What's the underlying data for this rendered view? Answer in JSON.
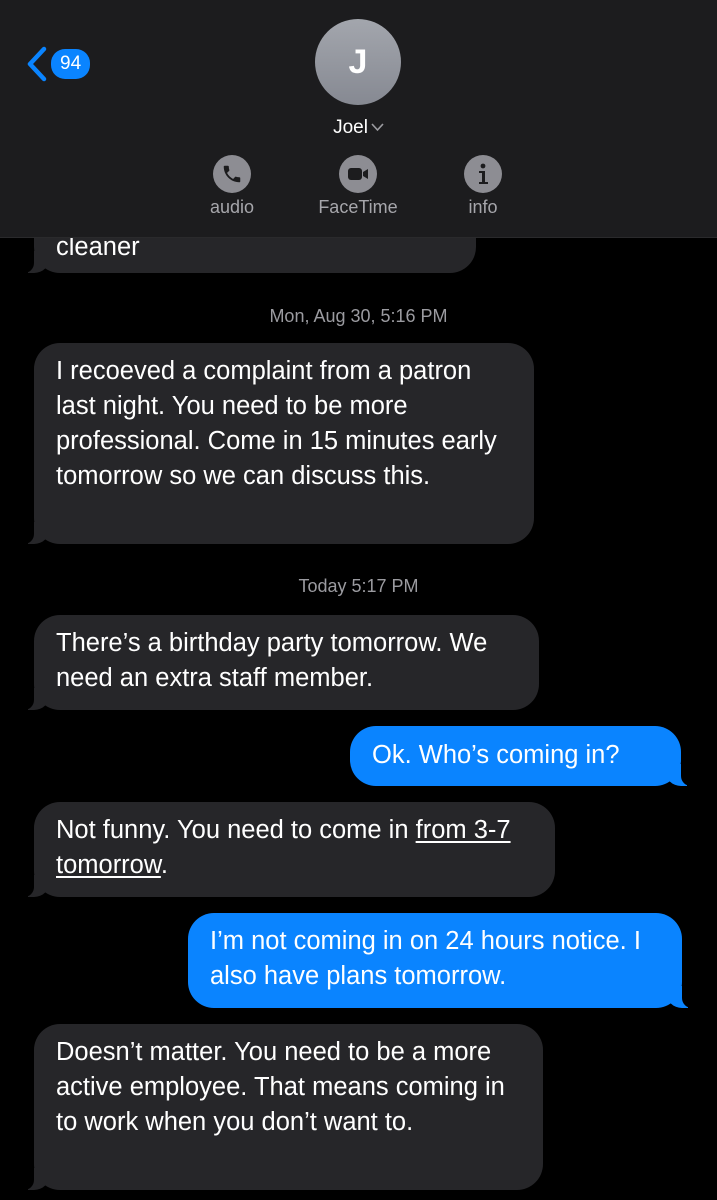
{
  "header": {
    "back_count": "94",
    "avatar_initial": "J",
    "contact_name": "Joel",
    "actions": [
      {
        "label": "audio",
        "icon": "phone-icon"
      },
      {
        "label": "FaceTime",
        "icon": "video-camera-icon"
      },
      {
        "label": "info",
        "icon": "info-icon"
      }
    ]
  },
  "thread": {
    "partial_message": "cleaner",
    "timestamps": [
      "Mon, Aug 30, 5:16 PM",
      "Today 5:17 PM"
    ],
    "messages": [
      {
        "from": "them",
        "text": "I recoeved a complaint from a patron last night. You need to be more professional. Come in 15 minutes early tomorrow so we can discuss this."
      },
      {
        "from": "them",
        "text": "There’s a birthday party tomorrow. We need an extra staff member."
      },
      {
        "from": "me",
        "text": "Ok. Who’s coming in?"
      },
      {
        "from": "them",
        "text_prefix": "Not funny. You need to come in ",
        "link_text": "from 3-7 tomorrow",
        "text_suffix": "."
      },
      {
        "from": "me",
        "text": "I’m not coming in on 24 hours notice. I also have plans tomorrow."
      },
      {
        "from": "them",
        "text": "Doesn’t matter. You need to be a more active employee. That means coming in to work when you don’t want to."
      }
    ]
  },
  "colors": {
    "incoming_bubble": "#262629",
    "outgoing_bubble": "#0a84ff",
    "header_bg": "#1c1c1e"
  }
}
